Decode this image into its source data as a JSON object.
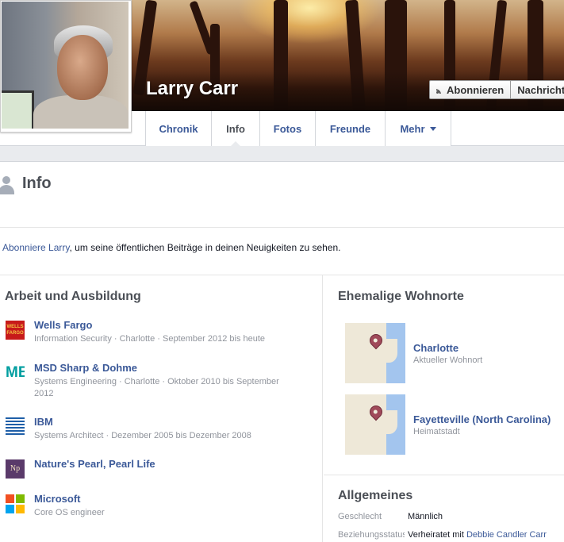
{
  "profile": {
    "name": "Larry Carr"
  },
  "cover_actions": {
    "subscribe": "Abonnieren",
    "message": "Nachricht"
  },
  "tabs": [
    {
      "label": "Chronik"
    },
    {
      "label": "Info"
    },
    {
      "label": "Fotos"
    },
    {
      "label": "Freunde"
    },
    {
      "label": "Mehr"
    }
  ],
  "info": {
    "title": "Info"
  },
  "subscribe_notice": {
    "link": "Abonniere Larry",
    "text": ", um seine öffentlichen Beiträge in deinen Neuigkeiten zu sehen."
  },
  "work": {
    "title": "Arbeit und Ausbildung",
    "items": [
      {
        "name": "Wells Fargo",
        "desc": "Information Security · Charlotte · September 2012 bis heute",
        "logo_text": "WELLS FARGO"
      },
      {
        "name": "MSD Sharp & Dohme",
        "desc": "Systems Engineering · Charlotte · Oktober 2010 bis September 2012",
        "logo_text": "MEI"
      },
      {
        "name": "IBM",
        "desc": "Systems Architect · Dezember 2005 bis Dezember 2008"
      },
      {
        "name": "Nature's Pearl, Pearl Life",
        "desc": "",
        "logo_text": "Np"
      },
      {
        "name": "Microsoft",
        "desc": "Core OS engineer"
      }
    ]
  },
  "places": {
    "title": "Ehemalige Wohnorte",
    "items": [
      {
        "name": "Charlotte",
        "desc": "Aktueller Wohnort"
      },
      {
        "name": "Fayetteville (North Carolina)",
        "desc": "Heimatstadt"
      }
    ]
  },
  "general": {
    "title": "Allgemeines",
    "rows": [
      {
        "label": "Geschlecht",
        "value": "Männlich"
      },
      {
        "label": "Beziehungsstatus",
        "value": "Verheiratet mit ",
        "link": "Debbie Candler Carr"
      }
    ]
  },
  "colors": {
    "link": "#3b5998",
    "muted": "#90949c",
    "page_bg": "#e9ebee"
  }
}
